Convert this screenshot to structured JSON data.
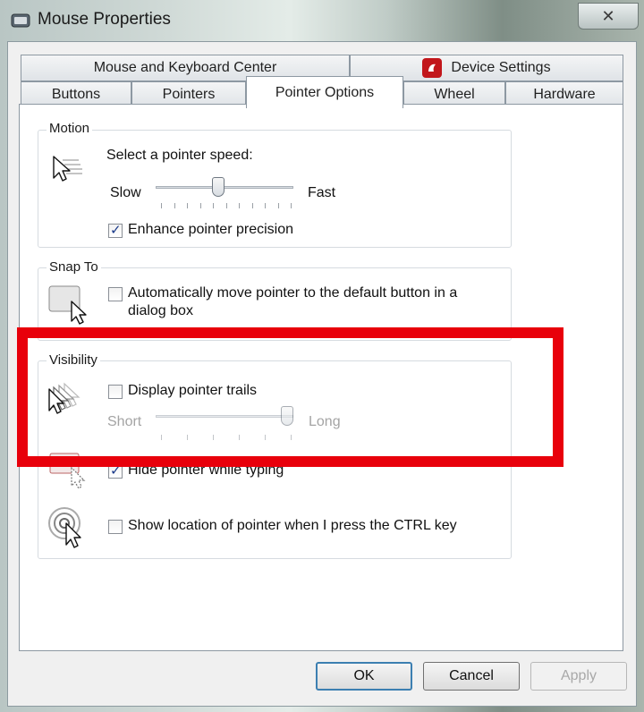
{
  "window": {
    "title": "Mouse Properties",
    "close_glyph": "✕"
  },
  "tabs_top": [
    {
      "label": "Mouse and Keyboard Center"
    },
    {
      "label": "Device Settings"
    }
  ],
  "tabs_bottom": [
    {
      "label": "Buttons"
    },
    {
      "label": "Pointers"
    },
    {
      "label": "Pointer Options"
    },
    {
      "label": "Wheel"
    },
    {
      "label": "Hardware"
    }
  ],
  "motion": {
    "title": "Motion",
    "speed_label": "Select a pointer speed:",
    "slow": "Slow",
    "fast": "Fast",
    "speed_level": 0.45,
    "enhance_label": "Enhance pointer precision",
    "enhance_checked": true
  },
  "snap": {
    "title": "Snap To",
    "auto_label_line1": "Automatically move pointer to the default button in a",
    "auto_label_line2": "dialog box",
    "auto_checked": false
  },
  "visibility": {
    "title": "Visibility",
    "trails_label": "Display pointer trails",
    "trails_checked": false,
    "short": "Short",
    "long": "Long",
    "trail_level": 1.0,
    "hide_label": "Hide pointer while typing",
    "hide_checked": true,
    "ctrl_label": "Show location of pointer when I press the CTRL key",
    "ctrl_checked": false
  },
  "buttons": {
    "ok": "OK",
    "cancel": "Cancel",
    "apply": "Apply"
  },
  "colors": {
    "highlight": "#e8000b",
    "device_icon": "#c2161b",
    "check": "#1a3a8a"
  }
}
